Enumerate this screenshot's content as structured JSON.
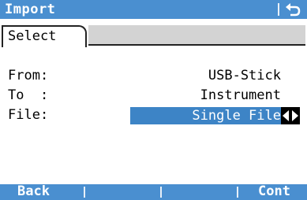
{
  "title_bar": {
    "title": "Import"
  },
  "tabs": [
    {
      "label": "Select"
    }
  ],
  "fields": [
    {
      "label": "From:",
      "value": "USB-Stick"
    },
    {
      "label": "To  :",
      "value": "Instrument"
    },
    {
      "label": "File:",
      "value": "Single File"
    }
  ],
  "softkeys": {
    "f1": "Back",
    "f2": "",
    "f3": "",
    "f4": "Cont"
  },
  "colors": {
    "accent": "#4a8fd0",
    "selection": "#3d84c6"
  },
  "icons": {
    "titlebar_right": "back-arrow-icon",
    "file_selector": "left-right-arrows-icon"
  }
}
